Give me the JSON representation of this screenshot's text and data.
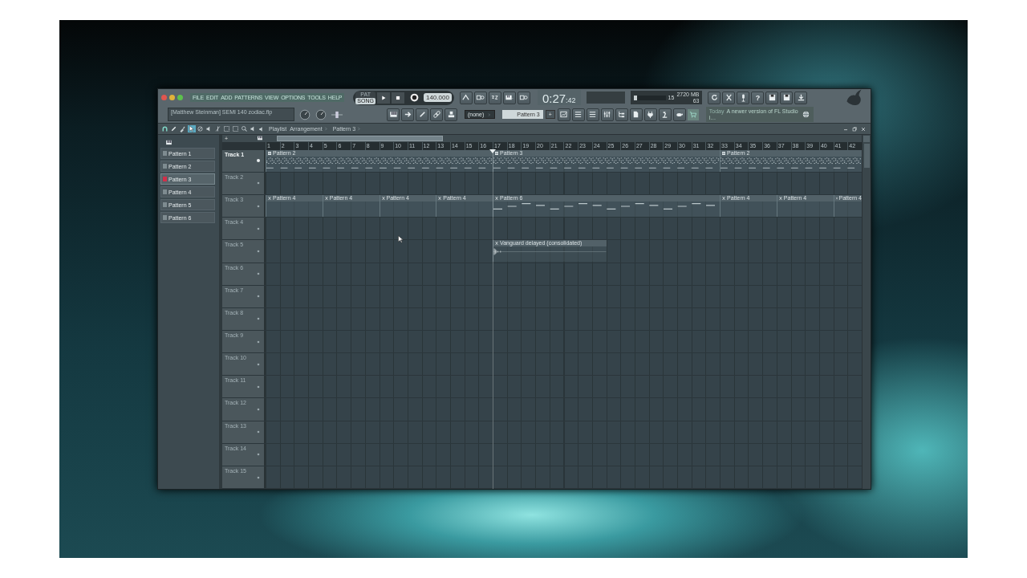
{
  "window": {
    "menu": [
      "FILE",
      "EDIT",
      "ADD",
      "PATTERNS",
      "VIEW",
      "OPTIONS",
      "TOOLS",
      "HELP"
    ],
    "mode": [
      {
        "label": "PAT",
        "selected": false
      },
      {
        "label": "SONG",
        "selected": true
      }
    ],
    "tempo": "140.000",
    "time": {
      "main": "0:27",
      "sub": ":42"
    },
    "cpu": {
      "reading": "15",
      "level": 0.12
    },
    "memory": "2720 MB",
    "polyphony": "63",
    "help": "?",
    "hint": "[Matthew Steinman] SEMI 140 zodiac.flp",
    "pattern_dropdown": "(none)",
    "pattern_selector": "Pattern 3",
    "add_pattern": "+",
    "news": {
      "date": "Today",
      "text": "A newer version of FL Studio i…"
    }
  },
  "playlist": {
    "breadcrumb": [
      "Playlist",
      "Arrangement",
      "Pattern 3"
    ],
    "patterns": [
      {
        "label": "Pattern 1",
        "selected": false
      },
      {
        "label": "Pattern 2",
        "selected": false
      },
      {
        "label": "Pattern 3",
        "selected": true
      },
      {
        "label": "Pattern 4",
        "selected": false
      },
      {
        "label": "Pattern 5",
        "selected": false
      },
      {
        "label": "Pattern 6",
        "selected": false
      }
    ],
    "add_track": "+",
    "ruler": [
      "1",
      "2",
      "3",
      "4",
      "5",
      "6",
      "7",
      "8",
      "9",
      "10",
      "11",
      "12",
      "13",
      "14",
      "15",
      "16",
      "17",
      "18",
      "19",
      "20",
      "21",
      "22",
      "23",
      "24",
      "25",
      "26",
      "27",
      "28",
      "29",
      "30",
      "31",
      "32",
      "33",
      "34",
      "35",
      "36",
      "37",
      "38",
      "39",
      "40",
      "41",
      "42"
    ],
    "tracks": [
      {
        "name": "Track 1",
        "selected": true,
        "clips": [
          {
            "kind": "notes",
            "label": "Pattern 2"
          },
          {
            "kind": "notes",
            "label": "Pattern 3"
          },
          {
            "kind": "notes",
            "label": "Pattern 2"
          }
        ]
      },
      {
        "name": "Track 2",
        "selected": false
      },
      {
        "name": "Track 3",
        "selected": false,
        "clips": [
          {
            "kind": "melody",
            "label": "Pattern 4"
          },
          {
            "kind": "melody",
            "label": "Pattern 4"
          },
          {
            "kind": "melody",
            "label": "Pattern 4"
          },
          {
            "kind": "melody",
            "label": "Pattern 4"
          },
          {
            "kind": "melody",
            "label": "Pattern 6"
          },
          {
            "kind": "melody",
            "label": "Pattern 4"
          },
          {
            "kind": "melody",
            "label": "Pattern 4"
          },
          {
            "kind": "melody",
            "label": "Pattern 4"
          }
        ]
      },
      {
        "name": "Track 4",
        "selected": false
      },
      {
        "name": "Track 5",
        "selected": false,
        "clips": [
          {
            "kind": "audio",
            "label": "Vanguard delayed (consolidated)"
          }
        ]
      },
      {
        "name": "Track 6",
        "selected": false
      },
      {
        "name": "Track 7",
        "selected": false
      },
      {
        "name": "Track 8",
        "selected": false
      },
      {
        "name": "Track 9",
        "selected": false
      },
      {
        "name": "Track 10",
        "selected": false
      },
      {
        "name": "Track 11",
        "selected": false
      },
      {
        "name": "Track 12",
        "selected": false
      },
      {
        "name": "Track 13",
        "selected": false
      },
      {
        "name": "Track 14",
        "selected": false
      },
      {
        "name": "Track 15",
        "selected": false
      }
    ]
  }
}
